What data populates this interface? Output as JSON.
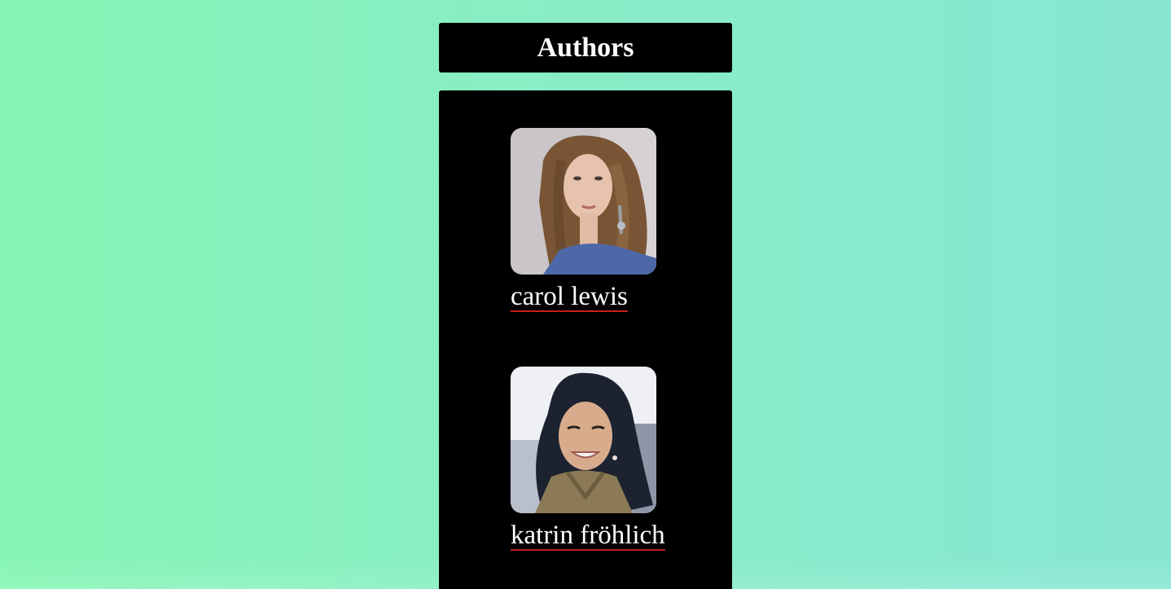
{
  "header": {
    "title": "Authors"
  },
  "authors": [
    {
      "name": "carol lewis",
      "photo_icon": "portrait-photo"
    },
    {
      "name": "katrin fröhlich",
      "photo_icon": "portrait-photo"
    }
  ],
  "colors": {
    "background_start": "#86f5b4",
    "background_end": "#88e6d3",
    "panel": "#000000",
    "text": "#ffffff",
    "link_underline": "#c81e1e"
  }
}
